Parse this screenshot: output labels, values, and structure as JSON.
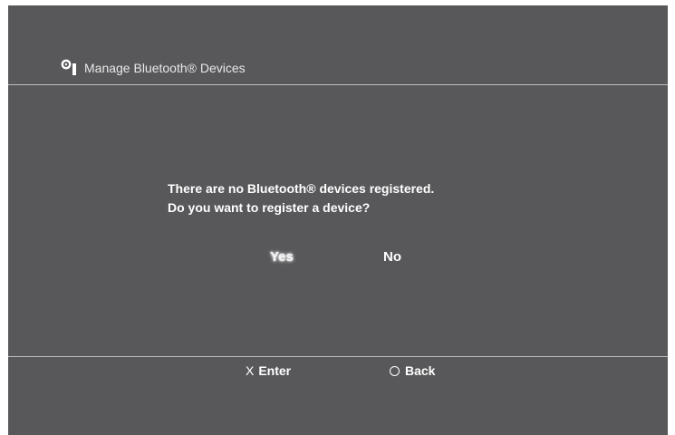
{
  "header": {
    "title": "Manage Bluetooth® Devices",
    "icon": "bluetooth-settings-icon"
  },
  "dialog": {
    "message_line1": "There are no Bluetooth® devices registered.",
    "message_line2": "Do you want to register a device?",
    "options": {
      "yes_label": "Yes",
      "no_label": "No",
      "selected": "Yes"
    }
  },
  "footer": {
    "enter_glyph": "X",
    "enter_label": "Enter",
    "back_glyph": "circle-icon",
    "back_label": "Back"
  },
  "colors": {
    "background": "#58585b",
    "text": "#ffffff",
    "divider": "#bdbdbd"
  }
}
